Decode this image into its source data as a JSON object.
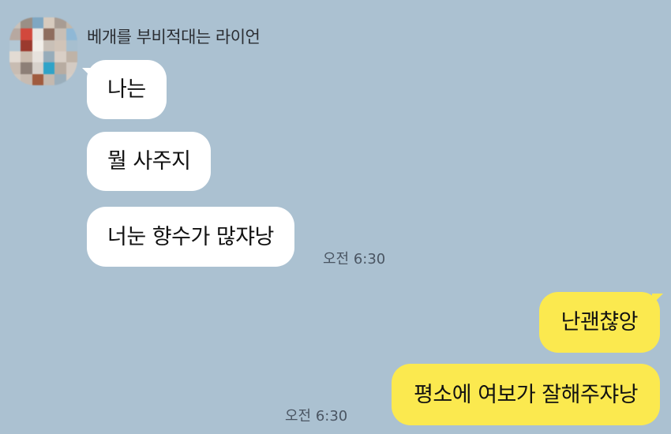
{
  "sender": {
    "name": "베개를 부비적대는 라이언",
    "avatar_colors": [
      "#c9c1b9",
      "#9a8f86",
      "#7fa7c2",
      "#d7cbbe",
      "#a89c93",
      "#c2b7ab",
      "#b7a8a0",
      "#d2483c",
      "#eae6e2",
      "#8e6d5e",
      "#c8bfb6",
      "#8fb8d6",
      "#b3c7d4",
      "#9b3a2e",
      "#f2efe9",
      "#c9c0b7",
      "#d1c4b8",
      "#a7bfcf",
      "#e3dbd3",
      "#cbbcaf",
      "#e7e2dd",
      "#96acba",
      "#d9cfc6",
      "#bfb3a7",
      "#c8bcb2",
      "#8d7f77",
      "#d7d1cb",
      "#2fa3c8",
      "#b8aca1",
      "#d4cbc3",
      "#cfc6bd",
      "#c7bbb1",
      "#a05b3e",
      "#c4b9af",
      "#9aaebb",
      "#d6cdc5"
    ]
  },
  "messages": {
    "incoming": [
      {
        "text": "나는"
      },
      {
        "text": "뭘 사주지"
      },
      {
        "text": "너눈 향수가 많쟈낭"
      }
    ],
    "incoming_time": "오전 6:30",
    "outgoing": [
      {
        "text": "난괜챦앙"
      },
      {
        "text": "평소에 여보가 잘해주쟈낭"
      }
    ],
    "outgoing_time": "오전 6:30"
  },
  "colors": {
    "background": "#abc1d1",
    "incoming_bubble": "#ffffff",
    "outgoing_bubble": "#fbe94f"
  }
}
